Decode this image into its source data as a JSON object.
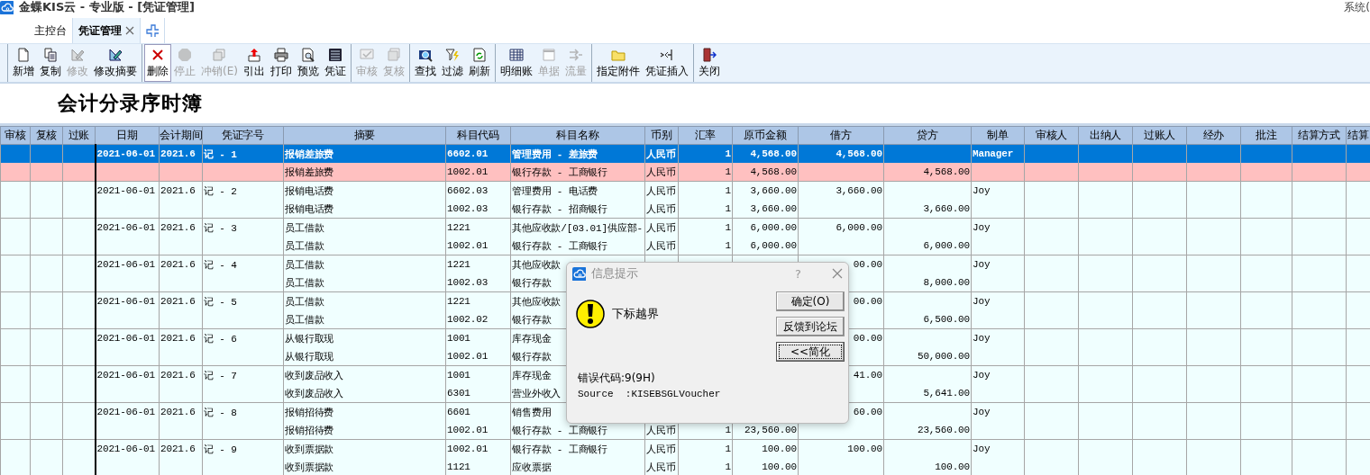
{
  "window": {
    "title": "金蝶KIS云 - 专业版 - [凭证管理]",
    "menu_right": "系统("
  },
  "tabs": [
    {
      "label": "主控台",
      "selected": false,
      "closable": false
    },
    {
      "label": "凭证管理",
      "selected": true,
      "closable": true
    }
  ],
  "toolbar": [
    [
      {
        "label": "新增",
        "disabled": false,
        "pressed": false
      },
      {
        "label": "复制",
        "disabled": false,
        "pressed": false
      },
      {
        "label": "修改",
        "disabled": true,
        "pressed": false
      },
      {
        "label": "修改摘要",
        "disabled": false,
        "pressed": false
      }
    ],
    [
      {
        "label": "删除",
        "disabled": false,
        "pressed": true
      },
      {
        "label": "停止",
        "disabled": true,
        "pressed": false
      },
      {
        "label": "冲销(E)",
        "disabled": true,
        "pressed": false
      },
      {
        "label": "引出",
        "disabled": false,
        "pressed": false
      },
      {
        "label": "打印",
        "disabled": false,
        "pressed": false
      },
      {
        "label": "预览",
        "disabled": false,
        "pressed": false
      },
      {
        "label": "凭证",
        "disabled": false,
        "pressed": false
      }
    ],
    [
      {
        "label": "审核",
        "disabled": true,
        "pressed": false
      },
      {
        "label": "复核",
        "disabled": true,
        "pressed": false
      }
    ],
    [
      {
        "label": "查找",
        "disabled": false,
        "pressed": false
      },
      {
        "label": "过滤",
        "disabled": false,
        "pressed": false
      },
      {
        "label": "刷新",
        "disabled": false,
        "pressed": false
      }
    ],
    [
      {
        "label": "明细账",
        "disabled": false,
        "pressed": false
      },
      {
        "label": "单据",
        "disabled": true,
        "pressed": false
      },
      {
        "label": "流量",
        "disabled": true,
        "pressed": false
      }
    ],
    [
      {
        "label": "指定附件",
        "disabled": false,
        "pressed": false
      },
      {
        "label": "凭证插入",
        "disabled": false,
        "pressed": false
      }
    ],
    [
      {
        "label": "关闭",
        "disabled": false,
        "pressed": false
      }
    ]
  ],
  "heading": "会计分录序时簿",
  "table": {
    "columns": [
      "审核",
      "复核",
      "过账",
      "日期",
      "会计期间",
      "凭证字号",
      "摘要",
      "科目代码",
      "科目名称",
      "币别",
      "汇率",
      "原币金额",
      "借方",
      "贷方",
      "制单",
      "审核人",
      "出纳人",
      "过账人",
      "经办",
      "批注",
      "结算方式",
      "结算"
    ],
    "vouchers": [
      {
        "date": "2021-06-01",
        "period": "2021.6",
        "number": "记 - 1",
        "preparer": "Manager",
        "selected": true,
        "lines": [
          {
            "selected": true,
            "summary": "报销差旅费",
            "code": "6602.01",
            "account": "管理费用 - 差旅费",
            "currency": "人民币",
            "rate": "1",
            "amount": "4,568.00",
            "debit": "4,568.00"
          },
          {
            "selected": false,
            "summary": "报销差旅费",
            "code": "1002.01",
            "account": "银行存款 - 工商银行",
            "currency": "人民币",
            "rate": "1",
            "amount": "4,568.00",
            "credit": "4,568.00"
          }
        ]
      },
      {
        "date": "2021-06-01",
        "period": "2021.6",
        "number": "记 - 2",
        "preparer": "Joy",
        "selected": false,
        "lines": [
          {
            "selected": false,
            "summary": "报销电话费",
            "code": "6602.03",
            "account": "管理费用 - 电话费",
            "currency": "人民币",
            "rate": "1",
            "amount": "3,660.00",
            "debit": "3,660.00"
          },
          {
            "selected": false,
            "summary": "报销电话费",
            "code": "1002.03",
            "account": "银行存款 - 招商银行",
            "currency": "人民币",
            "rate": "1",
            "amount": "3,660.00",
            "credit": "3,660.00"
          }
        ]
      },
      {
        "date": "2021-06-01",
        "period": "2021.6",
        "number": "记 - 3",
        "preparer": "Joy",
        "selected": false,
        "lines": [
          {
            "selected": false,
            "summary": "员工借款",
            "code": "1221",
            "account": "其他应收款/[03.01]供应部-",
            "currency": "人民币",
            "rate": "1",
            "amount": "6,000.00",
            "debit": "6,000.00"
          },
          {
            "selected": false,
            "summary": "员工借款",
            "code": "1002.01",
            "account": "银行存款 - 工商银行",
            "currency": "人民币",
            "rate": "1",
            "amount": "6,000.00",
            "credit": "6,000.00"
          }
        ]
      },
      {
        "date": "2021-06-01",
        "period": "2021.6",
        "number": "记 - 4",
        "preparer": "Joy",
        "selected": false,
        "lines": [
          {
            "selected": false,
            "summary": "员工借款",
            "code": "1221",
            "account": "其他应收款",
            "debit": "00.00"
          },
          {
            "selected": false,
            "summary": "员工借款",
            "code": "1002.03",
            "account": "银行存款",
            "credit": "8,000.00"
          }
        ]
      },
      {
        "date": "2021-06-01",
        "period": "2021.6",
        "number": "记 - 5",
        "preparer": "Joy",
        "selected": false,
        "lines": [
          {
            "selected": false,
            "summary": "员工借款",
            "code": "1221",
            "account": "其他应收款",
            "debit": "00.00"
          },
          {
            "selected": false,
            "summary": "员工借款",
            "code": "1002.02",
            "account": "银行存款",
            "credit": "6,500.00"
          }
        ]
      },
      {
        "date": "2021-06-01",
        "period": "2021.6",
        "number": "记 - 6",
        "preparer": "Joy",
        "selected": false,
        "lines": [
          {
            "selected": false,
            "summary": "从银行取现",
            "code": "1001",
            "account": "库存现金",
            "debit": "00.00"
          },
          {
            "selected": false,
            "summary": "从银行取现",
            "code": "1002.01",
            "account": "银行存款",
            "credit": "50,000.00"
          }
        ]
      },
      {
        "date": "2021-06-01",
        "period": "2021.6",
        "number": "记 - 7",
        "preparer": "Joy",
        "selected": false,
        "lines": [
          {
            "selected": false,
            "summary": "收到废品收入",
            "code": "1001",
            "account": "库存现金",
            "debit": "41.00"
          },
          {
            "selected": false,
            "summary": "收到废品收入",
            "code": "6301",
            "account": "营业外收入",
            "credit": "5,641.00"
          }
        ]
      },
      {
        "date": "2021-06-01",
        "period": "2021.6",
        "number": "记 - 8",
        "preparer": "Joy",
        "selected": false,
        "lines": [
          {
            "selected": false,
            "summary": "报销招待费",
            "code": "6601",
            "account": "销售费用",
            "debit": "60.00"
          },
          {
            "selected": false,
            "summary": "报销招待费",
            "code": "1002.01",
            "account": "银行存款 - 工商银行",
            "currency": "人民币",
            "rate": "1",
            "amount": "23,560.00",
            "credit": "23,560.00"
          }
        ]
      },
      {
        "date": "2021-06-01",
        "period": "2021.6",
        "number": "记 - 9",
        "preparer": "Joy",
        "selected": false,
        "lines": [
          {
            "selected": false,
            "summary": "收到票据款",
            "code": "1002.01",
            "account": "银行存款 - 工商银行",
            "currency": "人民币",
            "rate": "1",
            "amount": "100.00",
            "debit": "100.00"
          },
          {
            "selected": false,
            "summary": "收到票据款",
            "code": "1121",
            "account": "应收票据",
            "currency": "人民币",
            "rate": "1",
            "amount": "100.00",
            "credit": "100.00"
          }
        ]
      }
    ]
  },
  "dialog": {
    "title": "信息提示",
    "help": "?",
    "message": "下标越界",
    "buttons": [
      {
        "label": "确定(O)",
        "focused": false
      },
      {
        "label": "反馈到论坛",
        "focused": false
      },
      {
        "label": "<<简化",
        "focused": true
      }
    ],
    "error_code": "错误代码:9(9H)",
    "source": "Source  :KISEBSGLVoucher"
  }
}
